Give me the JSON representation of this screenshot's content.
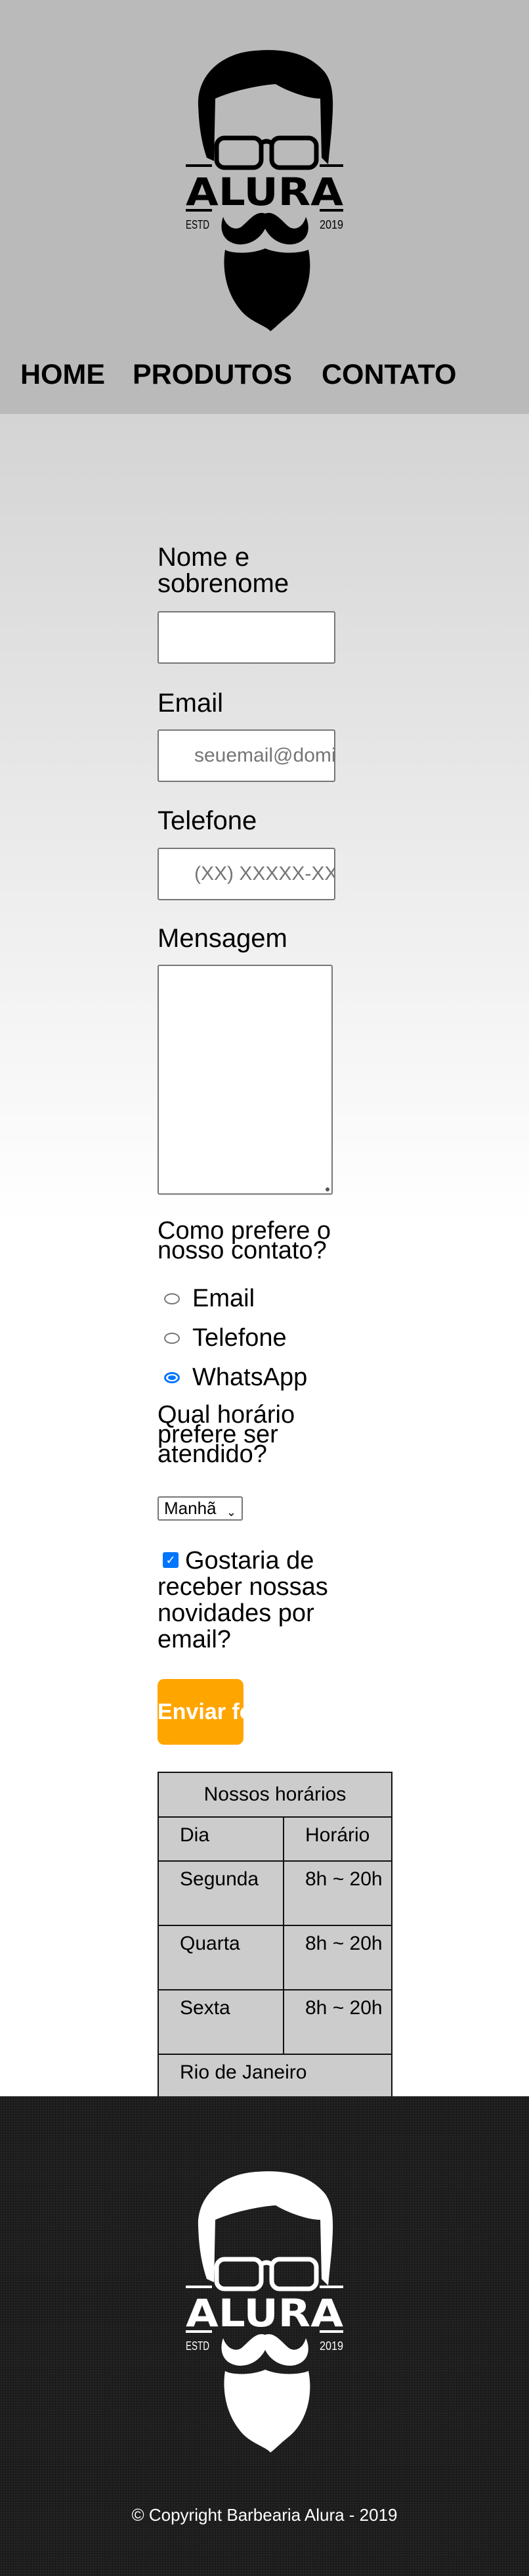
{
  "logo": {
    "brand": "ALURA",
    "estd": "ESTD",
    "year": "2019"
  },
  "nav": [
    {
      "label": "HOME"
    },
    {
      "label": "PRODUTOS"
    },
    {
      "label": "CONTATO"
    }
  ],
  "form": {
    "name_label": "Nome e sobrenome",
    "name_value": "",
    "email_label": "Email",
    "email_placeholder": "seuemail@dominio.com",
    "phone_label": "Telefone",
    "phone_placeholder": "(XX) XXXXX-XXXX",
    "message_label": "Mensagem",
    "contact_question": "Como prefere o nosso contato?",
    "contact_options": [
      {
        "label": "Email",
        "checked": false
      },
      {
        "label": "Telefone",
        "checked": false
      },
      {
        "label": "WhatsApp",
        "checked": true
      }
    ],
    "time_question": "Qual horário prefere ser atendido?",
    "time_selected": "Manhã",
    "newsletter_label": "Gostaria de receber nossas novidades por email?",
    "newsletter_checked": true,
    "submit_label": "Enviar formulário",
    "accent_color": "#ffa500"
  },
  "hours_table": {
    "caption": "Nossos horários",
    "headers": [
      "Dia",
      "Horário"
    ],
    "rows": [
      [
        "Segunda",
        "8h ~ 20h"
      ],
      [
        "Quarta",
        "8h ~ 20h"
      ],
      [
        "Sexta",
        "8h ~ 20h"
      ]
    ],
    "footer": "Rio de Janeiro"
  },
  "footer": {
    "copyright": "© Copyright Barbearia Alura - 2019"
  }
}
